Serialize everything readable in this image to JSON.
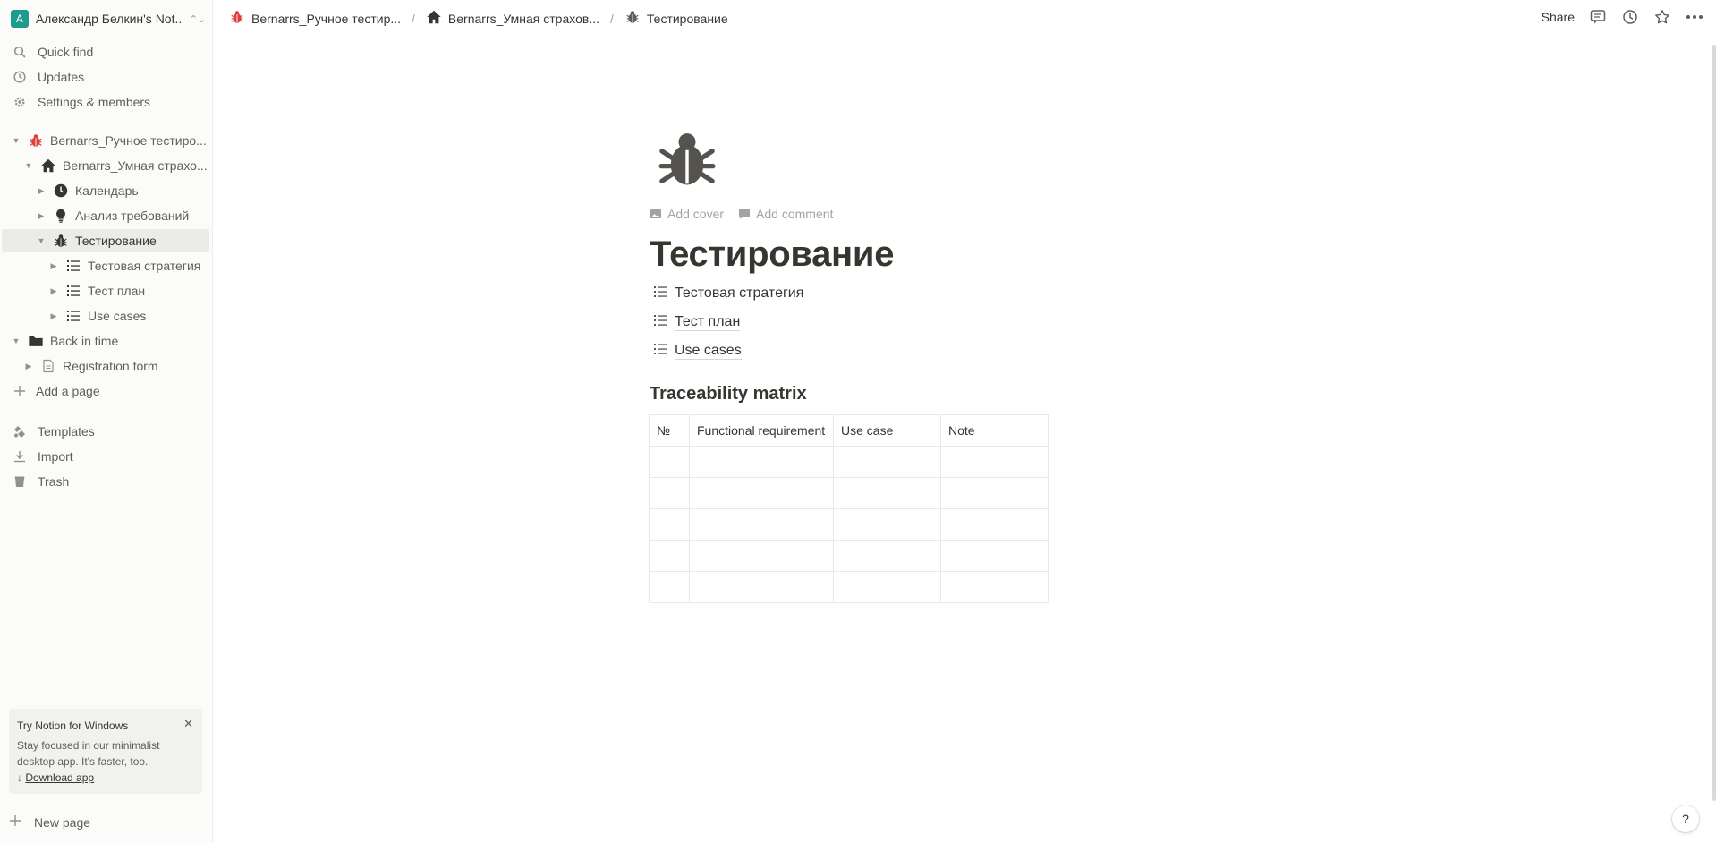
{
  "workspace": {
    "avatar": "A",
    "name": "Александр Белкин's Not..."
  },
  "sidebar": {
    "utils": [
      {
        "label": "Quick find",
        "icon": "search-icon"
      },
      {
        "label": "Updates",
        "icon": "clock-icon"
      },
      {
        "label": "Settings & members",
        "icon": "gear-icon"
      }
    ],
    "tree": [
      {
        "label": "Bernarrs_Ручное тестиро...",
        "icon": "bug-red-icon",
        "expanded": true
      },
      {
        "label": "Bernarrs_Умная страхо...",
        "icon": "house-icon",
        "expanded": true
      },
      {
        "label": "Календарь",
        "icon": "clock-icon",
        "expanded": false
      },
      {
        "label": "Анализ требований",
        "icon": "bulb-icon",
        "expanded": false
      },
      {
        "label": "Тестирование",
        "icon": "bug-icon",
        "expanded": true,
        "selected": true
      },
      {
        "label": "Тестовая стратегия",
        "icon": "list-icon",
        "expanded": false
      },
      {
        "label": "Тест план",
        "icon": "list-icon",
        "expanded": false
      },
      {
        "label": "Use cases",
        "icon": "list-icon",
        "expanded": false
      },
      {
        "label": "Back in time",
        "icon": "folder-icon",
        "expanded": true
      },
      {
        "label": "Registration form",
        "icon": "page-icon",
        "expanded": false
      }
    ],
    "add_page": "Add a page",
    "bottom_utils": [
      {
        "label": "Templates",
        "icon": "templates-icon"
      },
      {
        "label": "Import",
        "icon": "import-icon"
      },
      {
        "label": "Trash",
        "icon": "trash-icon"
      }
    ],
    "promo": {
      "title": "Try Notion for Windows",
      "text": "Stay focused in our minimalist desktop app. It's faster, too.",
      "link": "Download app"
    },
    "new_page": "New page"
  },
  "topbar": {
    "breadcrumbs": [
      {
        "label": "Bernarrs_Ручное тестир...",
        "icon": "bug-red-icon"
      },
      {
        "label": "Bernarrs_Умная страхов...",
        "icon": "house-icon"
      },
      {
        "label": "Тестирование",
        "icon": "bug-icon"
      }
    ],
    "separator": "/",
    "share": "Share"
  },
  "page": {
    "title": "Тестирование",
    "add_cover": "Add cover",
    "add_comment": "Add comment",
    "subpages": [
      "Тестовая стратегия",
      "Тест план",
      "Use cases"
    ],
    "heading": "Traceability matrix",
    "table": {
      "headers": [
        "№",
        "Functional requirement",
        "Use case",
        "Note"
      ],
      "rows": [
        [
          "",
          "",
          "",
          ""
        ],
        [
          "",
          "",
          "",
          ""
        ],
        [
          "",
          "",
          "",
          ""
        ],
        [
          "",
          "",
          "",
          ""
        ],
        [
          "",
          "",
          "",
          ""
        ]
      ]
    }
  },
  "help": "?",
  "colors": {
    "accent_bug": "#e03e3e",
    "avatar": "#1e9b8f",
    "text": "#37352f"
  }
}
